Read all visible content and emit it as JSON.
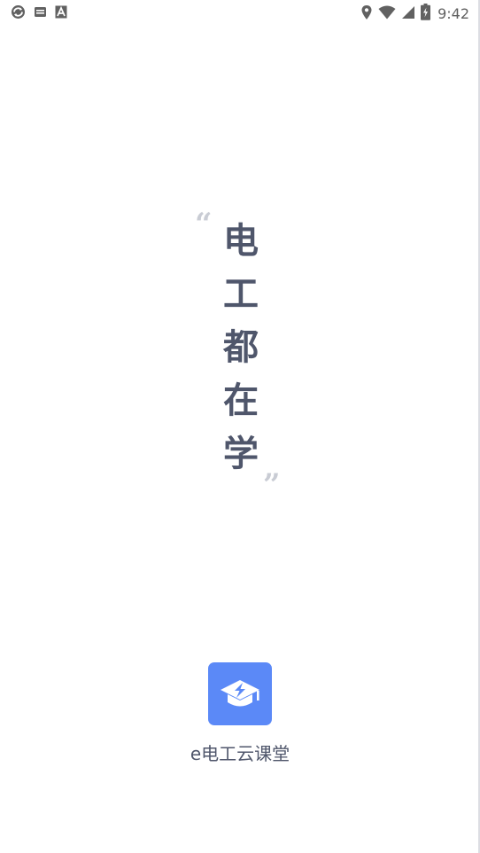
{
  "status_bar": {
    "time": "9:42",
    "left_icons": [
      "sync-icon",
      "sd-card-icon",
      "font-a-icon"
    ],
    "right_icons": [
      "location-pin-icon",
      "wifi-icon",
      "cell-signal-icon",
      "battery-charging-icon"
    ]
  },
  "splash": {
    "quote_open": "“",
    "quote_close": "”",
    "slogan": [
      "电",
      "工",
      "都",
      "在",
      "学"
    ],
    "app_name": "e电工云课堂",
    "logo_icon": "graduation-cap-lightning-icon",
    "colors": {
      "text": "#4f566b",
      "quote": "#c9ccd4",
      "logo_bg": "#5b89f7",
      "background": "#ffffff"
    }
  }
}
